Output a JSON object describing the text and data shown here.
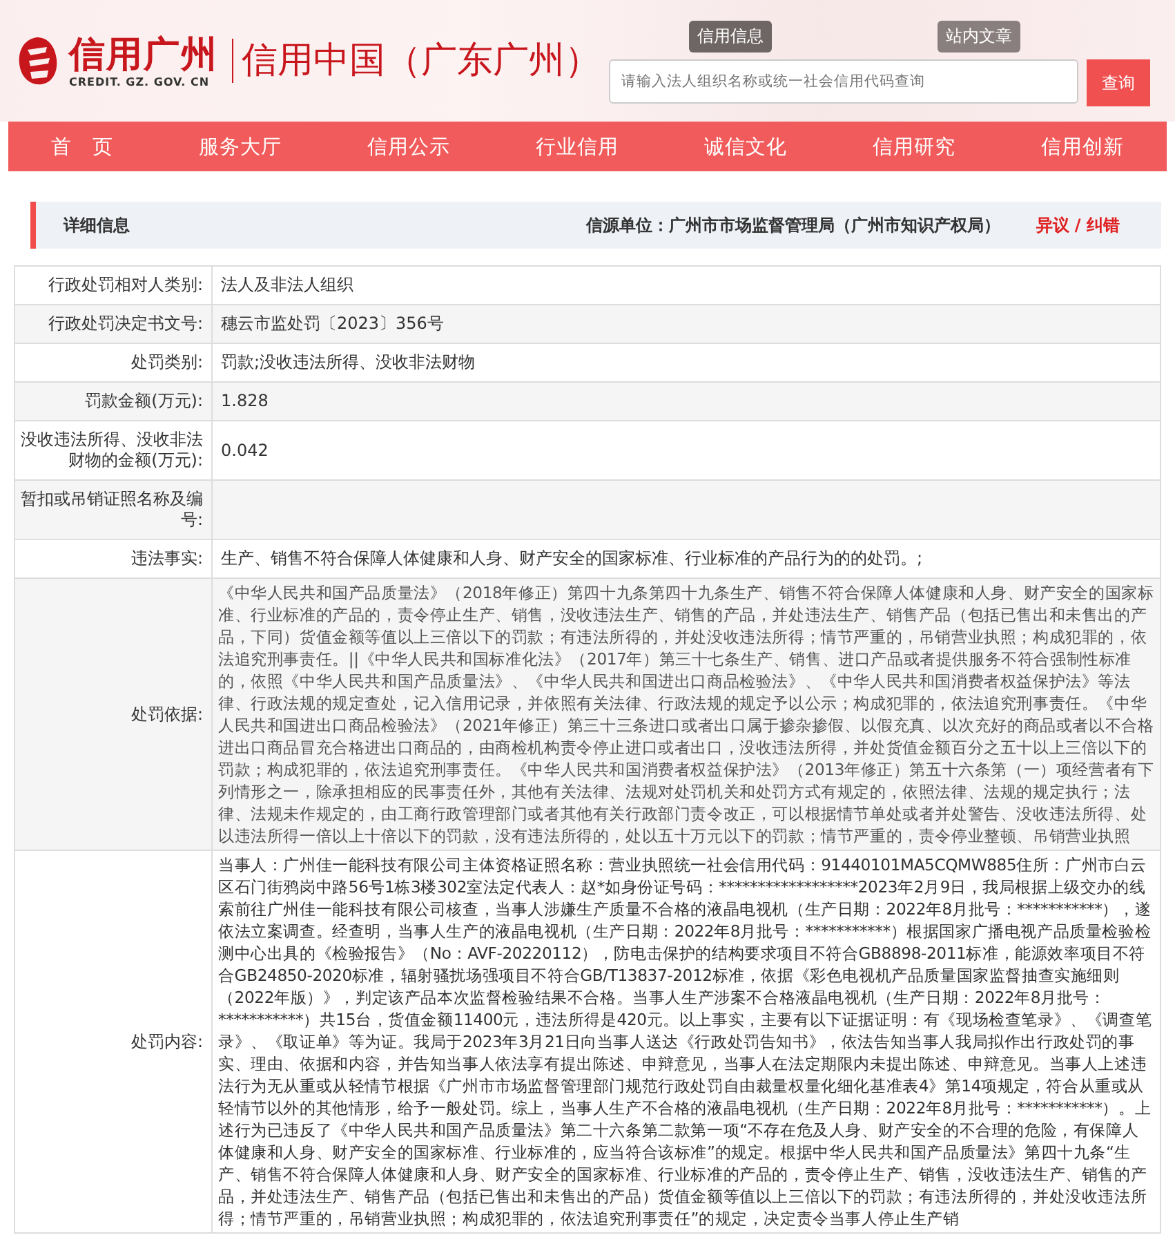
{
  "logo": {
    "name": "信用广州",
    "domain": "CREDIT. GZ. GOV. CN",
    "site_title": "信用中国（广东广州）"
  },
  "search": {
    "tabs": [
      {
        "label": "信用信息",
        "selected": true
      },
      {
        "label": "站内文章",
        "selected": false
      }
    ],
    "placeholder": "请输入法人组织名称或统一社会信用代码查询",
    "button": "查询"
  },
  "nav": [
    "首　页",
    "服务大厅",
    "信用公示",
    "行业信用",
    "诚信文化",
    "信用研究",
    "信用创新"
  ],
  "detail_header": {
    "title": "详细信息",
    "source": "信源单位：广州市市场监督管理局（广州市知识产权局）",
    "link": "异议 / 纠错"
  },
  "rows": [
    {
      "label": "行政处罚相对人类别:",
      "value": "法人及非法人组织",
      "kind": "plain"
    },
    {
      "label": "行政处罚决定书文号:",
      "value": "穗云市监处罚〔2023〕356号",
      "kind": "plain"
    },
    {
      "label": "处罚类别:",
      "value": "罚款;没收违法所得、没收非法财物",
      "kind": "plain"
    },
    {
      "label": "罚款金额(万元):",
      "value": "1.828",
      "kind": "plain"
    },
    {
      "label": "没收违法所得、没收非法财物的金额(万元):",
      "value": "0.042",
      "kind": "plain"
    },
    {
      "label": "暂扣或吊销证照名称及编号:",
      "kind": "plain"
    },
    {
      "label": "违法事实:",
      "value": "生产、销售不符合保障人体健康和人身、财产安全的国家标准、行业标准的产品行为的的处罚。;",
      "kind": "plain"
    },
    {
      "label": "处罚依据:",
      "value": "《中华人民共和国产品质量法》（2018年修正）第四十九条第四十九条生产、销售不符合保障人体健康和人身、财产安全的国家标准、行业标准的产品的，责令停止生产、销售，没收违法生产、销售的产品，并处违法生产、销售产品（包括已售出和未售出的产品，下同）货值金额等值以上三倍以下的罚款；有违法所得的，并处没收违法所得；情节严重的，吊销营业执照；构成犯罪的，依法追究刑事责任。||《中华人民共和国标准化法》（2017年）第三十七条生产、销售、进口产品或者提供服务不符合强制性标准的，依照《中华人民共和国产品质量法》、《中华人民共和国进出口商品检验法》、《中华人民共和国消费者权益保护法》等法律、行政法规的规定查处，记入信用记录，并依照有关法律、行政法规的规定予以公示；构成犯罪的，依法追究刑事责任。《中华人民共和国进出口商品检验法》（2021年修正）第三十三条进口或者出口属于掺杂掺假、以假充真、以次充好的商品或者以不合格进出口商品冒充合格进出口商品的，由商检机构责令停止进口或者出口，没收违法所得，并处货值金额百分之五十以上三倍以下的罚款；构成犯罪的，依法追究刑事责任。《中华人民共和国消费者权益保护法》（2013年修正）第五十六条第（一）项经营者有下列情形之一，除承担相应的民事责任外，其他有关法律、法规对处罚机关和处罚方式有规定的，依照法律、法规的规定执行；法律、法规未作规定的，由工商行政管理部门或者其他有关行政部门责令改正，可以根据情节单处或者并处警告、没收违法所得、处以违法所得一倍以上十倍以下的罚款，没有违法所得的，处以五十万元以下的罚款；情节严重的，责令停业整顿、吊销营业执照",
      "kind": "scroll"
    },
    {
      "label": "处罚内容:",
      "value": "当事人：广州佳一能科技有限公司主体资格证照名称：营业执照统一社会信用代码：91440101MA5CQMW885住所：广州市白云区石门街鸦岗中路56号1栋3楼302室法定代表人：赵*如身份证号码：******************2023年2月9日，我局根据上级交办的线索前往广州佳一能科技有限公司核查，当事人涉嫌生产质量不合格的液晶电视机（生产日期：2022年8月批号：***********），遂依法立案调查。经查明，当事人生产的液晶电视机（生产日期：2022年8月批号：***********）根据国家广播电视产品质量检验检测中心出具的《检验报告》（No：AVF-20220112），防电击保护的结构要求项目不符合GB8898-2011标准，能源效率项目不符合GB24850-2020标准，辐射骚扰场强项目不符合GB/T13837-2012标准，依据《彩色电视机产品质量国家监督抽查实施细则（2022年版）》，判定该产品本次监督检验结果不合格。当事人生产涉案不合格液晶电视机（生产日期：2022年8月批号：***********）共15台，货值金额11400元，违法所得是420元。以上事实，主要有以下证据证明：有《现场检查笔录》、《调查笔录》、《取证单》等为证。我局于2023年3月21日向当事人送达《行政处罚告知书》，依法告知当事人我局拟作出行政处罚的事实、理由、依据和内容，并告知当事人依法享有提出陈述、申辩意见，当事人在法定期限内未提出陈述、申辩意见。当事人上述违法行为无从重或从轻情节根据《广州市市场监督管理部门规范行政处罚自由裁量权量化细化基准表4》第14项规定，符合从重或从轻情节以外的其他情形，给予一般处罚。综上，当事人生产不合格的液晶电视机（生产日期：2022年8月批号：***********）。上述行为已违反了《中华人民共和国产品质量法》第二十六条第二款第一项“不存在危及人身、财产安全的不合理的危险，有保障人体健康和人身、财产安全的国家标准、行业标准的，应当符合该标准”的规定。根据中华人民共和国产品质量法》第四十九条“生产、销售不符合保障人体健康和人身、财产安全的国家标准、行业标准的产品的，责令停止生产、销售，没收违法生产、销售的产品，并处违法生产、销售产品（包括已售出和未售出的产品）货值金额等值以上三倍以下的罚款；有违法所得的，并处没收违法所得；情节严重的，吊销营业执照；构成犯罪的，依法追究刑事责任”的规定，决定责令当事人停止生产销",
      "kind": "plain"
    }
  ]
}
